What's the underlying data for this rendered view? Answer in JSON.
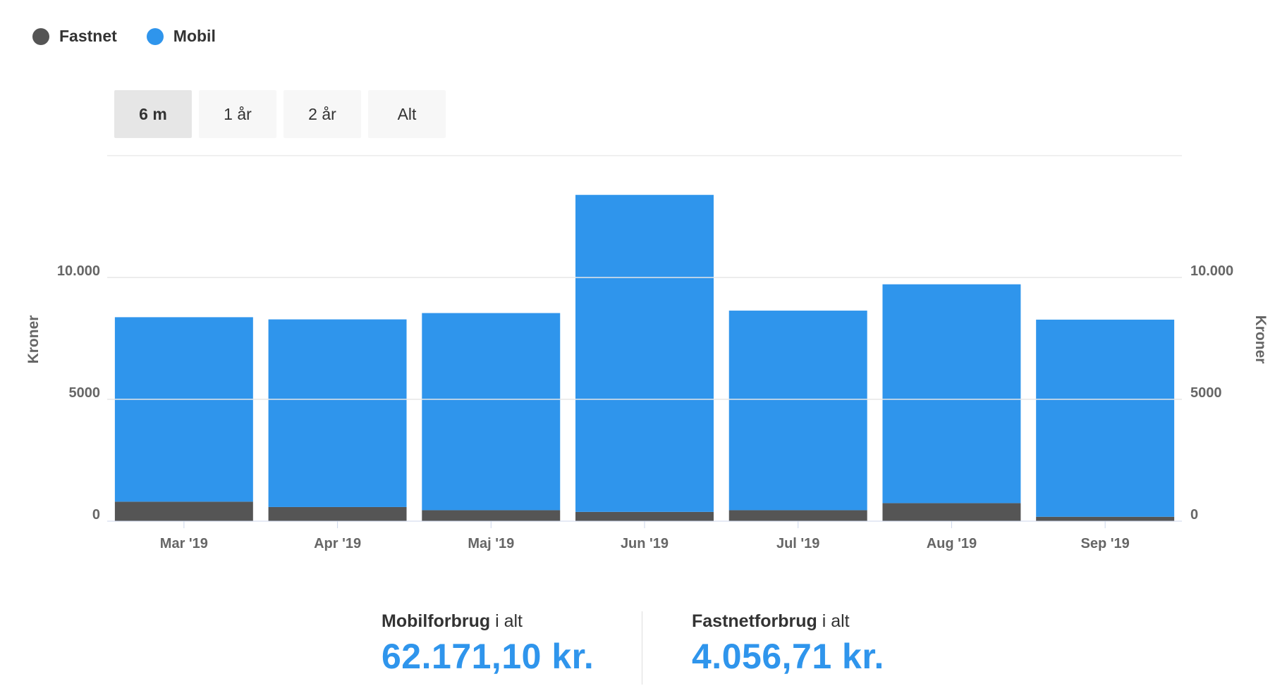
{
  "legend": {
    "items": [
      {
        "label": "Fastnet",
        "color": "#555555"
      },
      {
        "label": "Mobil",
        "color": "#2f95ec"
      }
    ]
  },
  "range_buttons": [
    {
      "label": "6 m",
      "active": true
    },
    {
      "label": "1 år",
      "active": false
    },
    {
      "label": "2 år",
      "active": false
    },
    {
      "label": "Alt",
      "active": false
    }
  ],
  "chart_data": {
    "type": "bar",
    "stacked": true,
    "categories": [
      "Mar '19",
      "Apr '19",
      "Maj '19",
      "Jun '19",
      "Jul '19",
      "Aug '19",
      "Sep '19"
    ],
    "series": [
      {
        "name": "Fastnet",
        "color": "#555555",
        "values": [
          800,
          580,
          450,
          380,
          450,
          740,
          180
        ]
      },
      {
        "name": "Mobil",
        "color": "#2f95ec",
        "values": [
          7570,
          7700,
          8090,
          13010,
          8190,
          8980,
          8090
        ]
      }
    ],
    "ylabel": "Kroner",
    "ylabel_right": "Kroner",
    "ylim": [
      0,
      15000
    ],
    "yticks": [
      0,
      5000,
      10000
    ],
    "ytick_labels": [
      "0",
      "5000",
      "10.000"
    ],
    "grid": true,
    "legend_position": "top-left"
  },
  "totals": {
    "mobil": {
      "label_bold": "Mobilforbrug",
      "label_rest": " i alt",
      "value": "62.171,10 kr."
    },
    "fastnet": {
      "label_bold": "Fastnetforbrug",
      "label_rest": " i alt",
      "value": "4.056,71 kr."
    }
  }
}
